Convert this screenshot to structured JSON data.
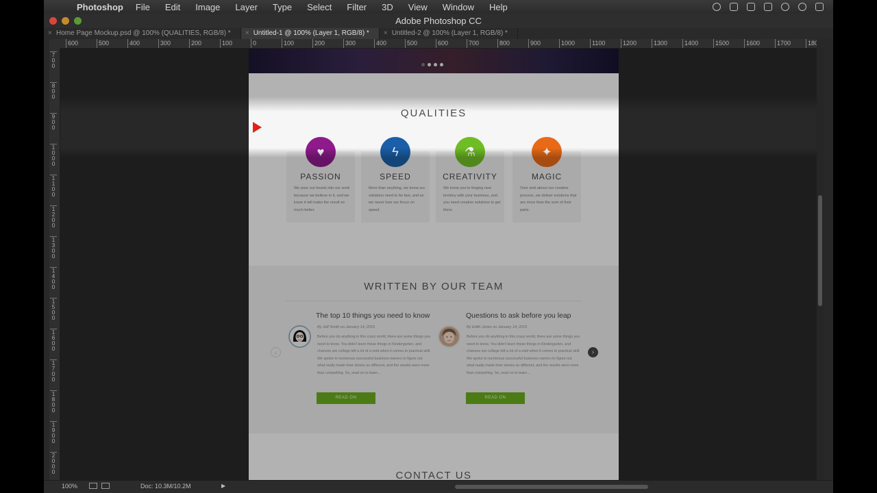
{
  "menubar": {
    "app_name": "Photoshop",
    "menus": [
      "File",
      "Edit",
      "Image",
      "Layer",
      "Type",
      "Select",
      "Filter",
      "3D",
      "View",
      "Window",
      "Help"
    ]
  },
  "window": {
    "title": "Adobe Photoshop CC"
  },
  "tabs": [
    {
      "label": "Home Page Mockup.psd @ 100% (QUALITIES, RGB/8) *",
      "active": false
    },
    {
      "label": "Untitled-1 @ 100% (Layer 1, RGB/8) *",
      "active": true
    },
    {
      "label": "Untitled-2 @ 100% (Layer 1, RGB/8) *",
      "active": false
    }
  ],
  "ruler_top": [
    "600",
    "500",
    "400",
    "300",
    "200",
    "100",
    "0",
    "100",
    "200",
    "300",
    "400",
    "500",
    "600",
    "700",
    "800",
    "900",
    "1000",
    "1100",
    "1200",
    "1300",
    "1400",
    "1500",
    "1600",
    "1700",
    "180"
  ],
  "ruler_left": [
    "700",
    "800",
    "900",
    "1000",
    "1100",
    "1200",
    "1300",
    "1400",
    "1500",
    "1600",
    "1700",
    "1800",
    "1900",
    "2000"
  ],
  "qualities": {
    "title": "QUALITIES",
    "items": [
      {
        "name": "PASSION",
        "icon": "heart-icon",
        "glyph": "♥",
        "color": "#8e1a8c",
        "text": "We pour our hearts into our work because we believe in it, and we know it will make the result so much better."
      },
      {
        "name": "SPEED",
        "icon": "lightning-icon",
        "glyph": "ϟ",
        "color": "#1a5fa8",
        "text": "More than anything, we know our solutions need to be fast, and so we never lose our focus on speed."
      },
      {
        "name": "CREATIVITY",
        "icon": "flask-icon",
        "glyph": "⚗",
        "color": "#6fbd25",
        "text": "We know you're forging new territory with your business, and you need creative solutions to get there."
      },
      {
        "name": "MAGIC",
        "icon": "magic-wand-icon",
        "glyph": "✦",
        "color": "#e86a18",
        "text": "Over and above our creative process, we deliver solutions that are more than the sum of their parts."
      }
    ]
  },
  "team": {
    "title": "WRITTEN BY OUR TEAM",
    "posts": [
      {
        "title": "The top 10 things you need to know",
        "meta": "By Jeff Smith on January 14, 2015",
        "body": "Before you do anything in this crazy world, there are some things you need to know. You didn't learn these things in Kindergarten, and chances are college left a lot of a void when it comes to practical skill. We spoke to numerous successful business owners to figure out what really made their stories so different, and the results were more than compelling. So, read on to learn...",
        "button": "READ ON"
      },
      {
        "title": "Questions to ask before you leap",
        "meta": "By Edith Jones on January 14, 2015",
        "body": "Before you do anything in this crazy world, there are some things you need to know. You didn't learn these things in Kindergarten, and chances are college left a lot of a void when it comes to practical skill. We spoke to numerous successful business owners to figure out what really made their stories so different, and the results were more than compelling. So, read on to learn...",
        "button": "READ ON"
      }
    ],
    "prev_glyph": "‹",
    "next_glyph": "›"
  },
  "contact": {
    "title": "CONTACT US"
  },
  "statusbar": {
    "zoom": "100%",
    "doc": "Doc: 10.3M/10.2M",
    "arrow": "▶"
  }
}
